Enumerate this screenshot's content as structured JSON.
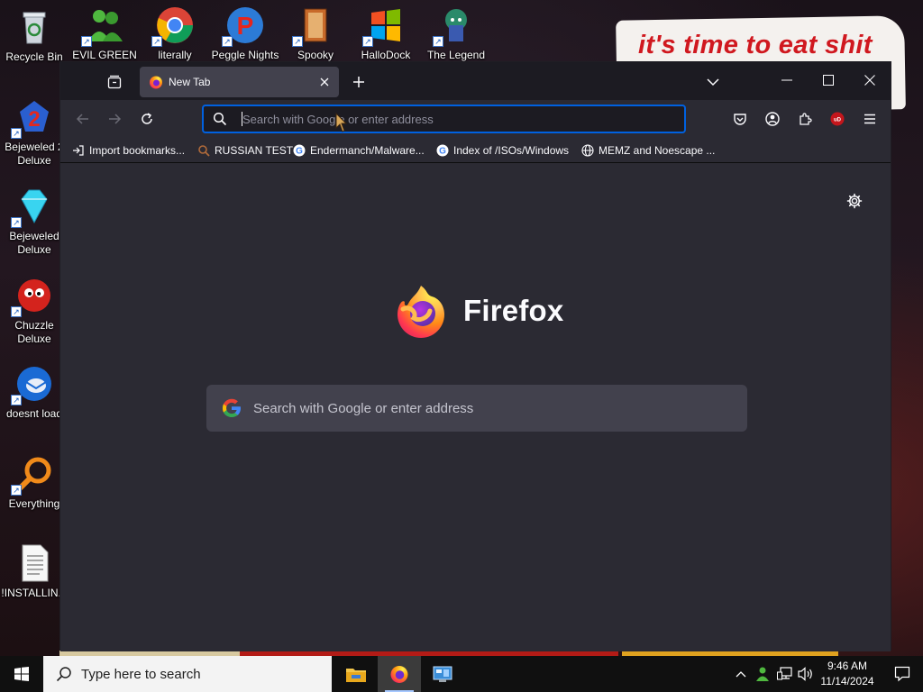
{
  "desktop": {
    "meme_text": "it's time to eat shit",
    "left_icons": [
      {
        "label": "Recycle Bin",
        "icon": "recycle-bin-icon"
      },
      {
        "label": "Bejeweled 2 Deluxe",
        "icon": "bejeweled-2-icon"
      },
      {
        "label": "Bejeweled Deluxe",
        "icon": "bejeweled-icon"
      },
      {
        "label": "Chuzzle Deluxe",
        "icon": "chuzzle-icon"
      },
      {
        "label": "doesnt load",
        "icon": "thunderbird-icon"
      },
      {
        "label": "Everything",
        "icon": "everything-icon"
      },
      {
        "label": "!INSTALLIN...",
        "icon": "text-file-icon"
      }
    ],
    "top_icons": [
      {
        "label": "EVIL GREEN",
        "icon": "messenger-icon"
      },
      {
        "label": "literally",
        "icon": "chrome-icon"
      },
      {
        "label": "Peggle Nights",
        "icon": "peggle-icon"
      },
      {
        "label": "Spooky",
        "icon": "spooky-icon"
      },
      {
        "label": "HalloDock",
        "icon": "windows-logo-icon"
      },
      {
        "label": "The Legend",
        "icon": "legend-icon"
      }
    ]
  },
  "browser": {
    "tab": {
      "title": "New Tab"
    },
    "urlbar": {
      "placeholder": "Search with Google or enter address"
    },
    "bookmarks": [
      {
        "label": "Import bookmarks...",
        "icon": "import-icon"
      },
      {
        "label": "RUSSIAN TEST",
        "icon": "search-person-icon"
      },
      {
        "label": "Endermanch/Malware...",
        "icon": "google-icon"
      },
      {
        "label": "Index of /ISOs/Windows",
        "icon": "google-icon"
      },
      {
        "label": "MEMZ and Noescape ...",
        "icon": "globe-icon"
      }
    ],
    "newtab": {
      "wordmark": "Firefox",
      "search_placeholder": "Search with Google or enter address"
    }
  },
  "taskbar": {
    "search_placeholder": "Type here to search",
    "apps": [
      "file-explorer-icon",
      "firefox-icon",
      "control-panel-icon"
    ],
    "clock": {
      "time": "9:46 AM",
      "date": "11/14/2024"
    }
  },
  "colors": {
    "accent": "#0061e0",
    "chrome_dark": "#1c1b22",
    "chrome": "#2b2a33",
    "tab_active": "#42414d",
    "meme_red": "#d0181f"
  }
}
